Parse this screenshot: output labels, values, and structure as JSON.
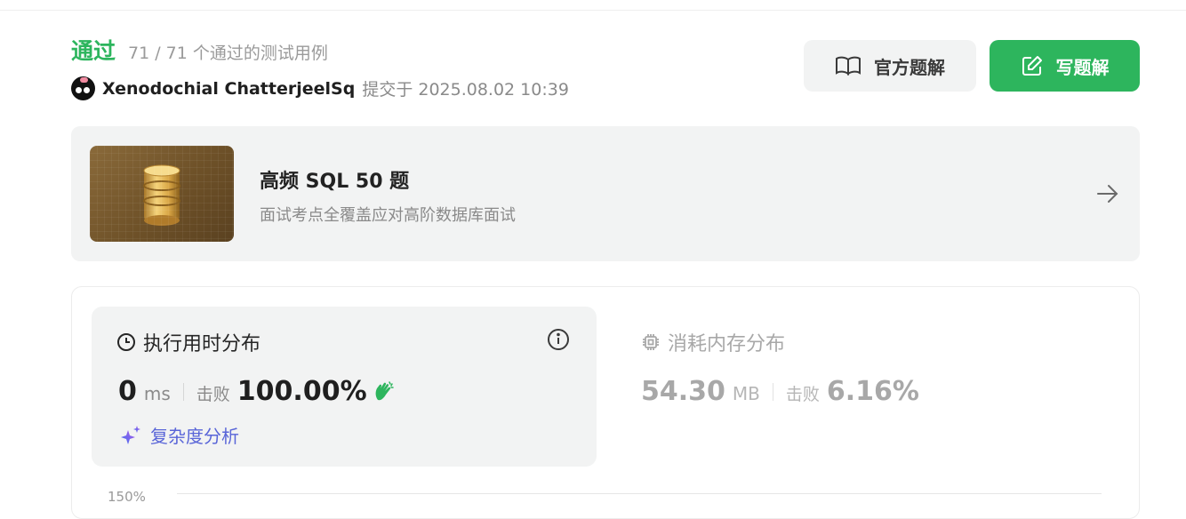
{
  "result": {
    "status": "通过",
    "test_count": "71 / 71 个通过的测试用例",
    "user_name": "Xenodochial ChatterjeelSq",
    "submitted_at": "提交于 2025.08.02 10:39"
  },
  "actions": {
    "official_solution": "官方题解",
    "write_solution": "写题解"
  },
  "study_plan": {
    "title": "高频 SQL 50 题",
    "subtitle": "面试考点全覆盖应对高阶数据库面试"
  },
  "runtime": {
    "title": "执行用时分布",
    "value": "0",
    "unit": "ms",
    "beat_label": "击败",
    "percentile": "100.00%",
    "complexity_link": "复杂度分析"
  },
  "memory": {
    "title": "消耗内存分布",
    "value": "54.30",
    "unit": "MB",
    "beat_label": "击败",
    "percentile": "6.16%"
  },
  "chart": {
    "top_tick": "150%"
  },
  "colors": {
    "accent_green": "#2db55d",
    "link_purple": "#5965d8",
    "muted_gray": "#a8a8a8"
  },
  "icons": {
    "official_solution": "book-open-icon",
    "write_solution": "edit-icon",
    "card_arrow": "arrow-right-icon",
    "runtime": "clock-icon",
    "info": "info-icon",
    "clap": "clap-icon",
    "complexity": "sparkle-icon",
    "memory": "chip-icon"
  }
}
